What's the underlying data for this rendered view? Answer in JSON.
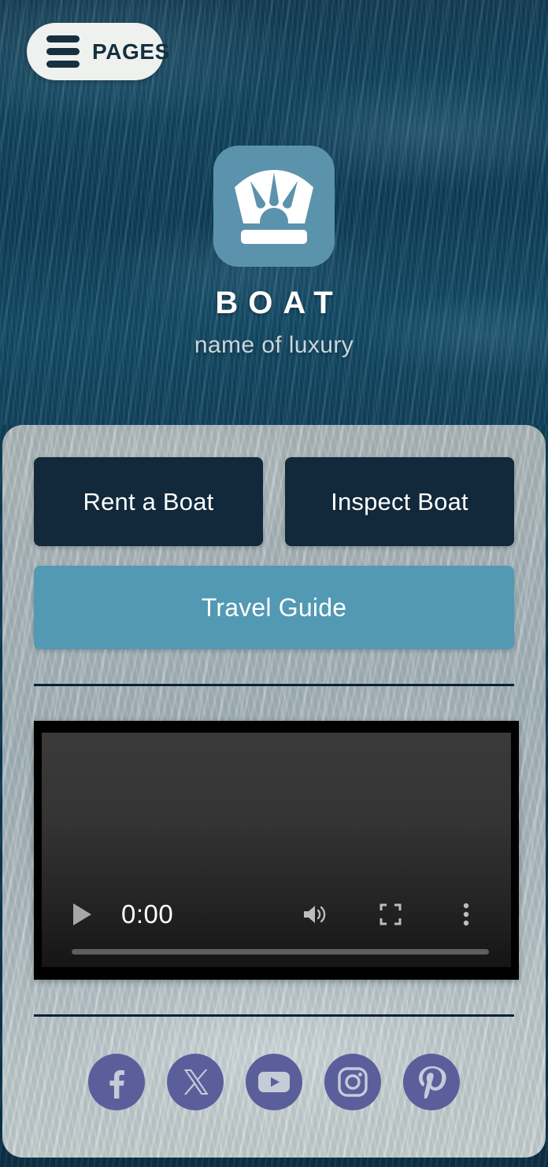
{
  "header": {
    "menu_button_label": "PAGES",
    "menu_icon": "hamburger-icon"
  },
  "brand": {
    "logo_icon": "crown-boat-logo-icon",
    "title": "BOAT",
    "subtitle": "name of luxury",
    "logo_tile_color": "#5b93ac"
  },
  "actions": {
    "rent_label": "Rent a Boat",
    "inspect_label": "Inspect Boat",
    "travel_guide_label": "Travel Guide",
    "dark_button_color": "#12293b",
    "accent_button_color": "#5299b3"
  },
  "video": {
    "play_icon": "play-icon",
    "current_time": "0:00",
    "volume_icon": "volume-icon",
    "fullscreen_icon": "fullscreen-icon",
    "more_icon": "more-vertical-icon",
    "progress_percent": 0
  },
  "social": {
    "icon_color": "#5a5f9b",
    "items": [
      {
        "name": "facebook-icon",
        "label": "Facebook"
      },
      {
        "name": "x-twitter-icon",
        "label": "X"
      },
      {
        "name": "youtube-icon",
        "label": "YouTube"
      },
      {
        "name": "instagram-icon",
        "label": "Instagram"
      },
      {
        "name": "pinterest-icon",
        "label": "Pinterest"
      }
    ]
  },
  "theme": {
    "hero_water_color": "#10455f",
    "card_surface_color": "#a9b2b2",
    "divider_color": "#0d2230"
  }
}
